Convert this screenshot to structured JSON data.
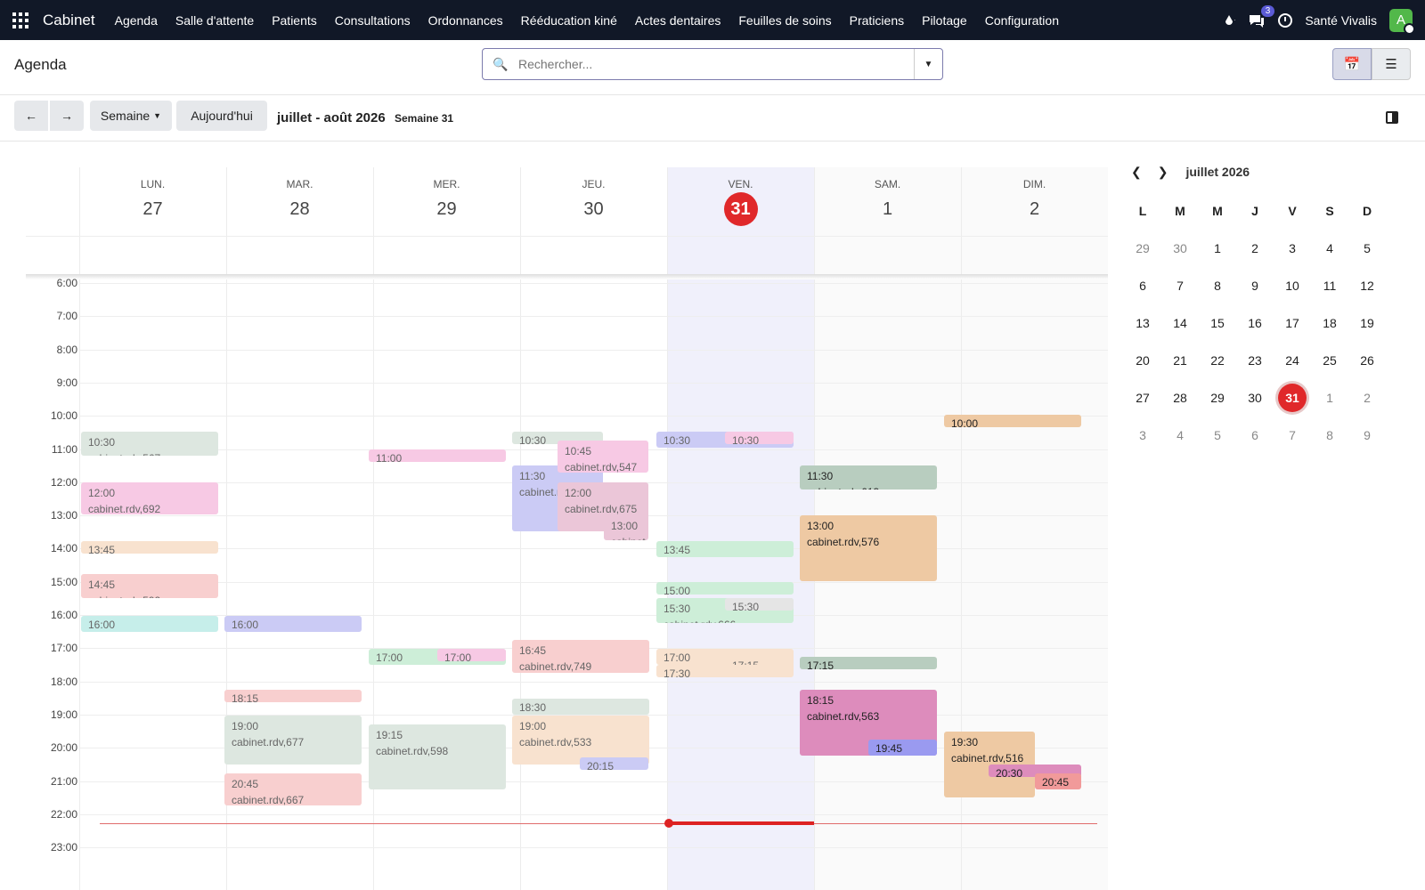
{
  "topbar": {
    "app": "Cabinet",
    "menu": [
      "Agenda",
      "Salle d'attente",
      "Patients",
      "Consultations",
      "Ordonnances",
      "Rééducation kiné",
      "Actes dentaires",
      "Feuilles de soins",
      "Praticiens",
      "Pilotage",
      "Configuration"
    ],
    "chat_count": "3",
    "company": "Santé Vivalis",
    "avatar": "A"
  },
  "control": {
    "title": "Agenda",
    "search_placeholder": "Rechercher..."
  },
  "nav": {
    "scale": "Semaine",
    "today": "Aujourd'hui",
    "range": "juillet - août 2026",
    "week": "Semaine 31"
  },
  "days": [
    {
      "name": "LUN.",
      "num": "27"
    },
    {
      "name": "MAR.",
      "num": "28"
    },
    {
      "name": "MER.",
      "num": "29"
    },
    {
      "name": "JEU.",
      "num": "30"
    },
    {
      "name": "VEN.",
      "num": "31"
    },
    {
      "name": "SAM.",
      "num": "1"
    },
    {
      "name": "DIM.",
      "num": "2"
    }
  ],
  "hours": [
    "6:00",
    "7:00",
    "8:00",
    "9:00",
    "10:00",
    "11:00",
    "12:00",
    "13:00",
    "14:00",
    "15:00",
    "16:00",
    "17:00",
    "18:00",
    "19:00",
    "20:00",
    "21:00",
    "22:00",
    "23:00"
  ],
  "events": [
    {
      "time": "10:30",
      "label": "cabinet.rdv,567",
      "color": "#dde7e0"
    },
    {
      "time": "12:00",
      "label": "cabinet.rdv,692",
      "color": "#f7c9e4"
    },
    {
      "time": "13:45",
      "label": "",
      "color": "#f8e2cf"
    },
    {
      "time": "14:45",
      "label": "cabinet.rdv,592",
      "color": "#f8cfcf"
    },
    {
      "time": "16:00",
      "label": "",
      "color": "#c6eeea"
    },
    {
      "time": "16:00",
      "label": "",
      "color": "#cbcbf5"
    },
    {
      "time": "18:15",
      "label": "",
      "color": "#f8cfcf"
    },
    {
      "time": "19:00",
      "label": "cabinet.rdv,677",
      "color": "#dde7e0"
    },
    {
      "time": "20:45",
      "label": "cabinet.rdv,667",
      "color": "#f8cfcf"
    },
    {
      "time": "11:00",
      "label": "",
      "color": "#f7c9e4"
    },
    {
      "time": "17:00",
      "label": "",
      "color": "#cdeed8"
    },
    {
      "time": "17:00",
      "label": "",
      "color": "#f7c9e4"
    },
    {
      "time": "19:15",
      "label": "cabinet.rdv,598",
      "color": "#dde7e0"
    },
    {
      "time": "10:30",
      "label": "",
      "color": "#dde7e0"
    },
    {
      "time": "11:30",
      "label": "cabinet.rdv",
      "color": "#cbcbf5"
    },
    {
      "time": "10:45",
      "label": "cabinet.rdv,547",
      "color": "#f7c9e4"
    },
    {
      "time": "12:00",
      "label": "cabinet.rdv,675",
      "color": "#ebc6d8"
    },
    {
      "time": "13:00",
      "label": "cabinet",
      "color": "#ebc6d8"
    },
    {
      "time": "16:45",
      "label": "cabinet.rdv,749",
      "color": "#f8cfcf"
    },
    {
      "time": "18:30",
      "label": "",
      "color": "#dde7e0"
    },
    {
      "time": "19:00",
      "label": "cabinet.rdv,533",
      "color": "#f8e2cf"
    },
    {
      "time": "20:15",
      "label": "",
      "color": "#cbcbf5"
    },
    {
      "time": "10:30",
      "label": "",
      "color": "#cbcbf5"
    },
    {
      "time": "10:30",
      "label": "",
      "color": "#f7c9e4"
    },
    {
      "time": "13:45",
      "label": "",
      "color": "#cdeed8"
    },
    {
      "time": "15:00",
      "label": "",
      "color": "#cdeed8"
    },
    {
      "time": "15:30",
      "label": "cabinet.rdv,666",
      "color": "#cdeed8"
    },
    {
      "time": "15:30",
      "label": "",
      "color": "#e5e5e5"
    },
    {
      "time": "17:00",
      "label": "",
      "color": "#f8e2cf"
    },
    {
      "time": "17:15",
      "label": "",
      "color": "#f8e2cf"
    },
    {
      "time": "17:30",
      "label": "",
      "color": "#f8e2cf"
    },
    {
      "time": "11:30",
      "label": "cabinet.rdv,613",
      "color": "#b8cdbf"
    },
    {
      "time": "13:00",
      "label": "cabinet.rdv,576",
      "color": "#eec9a3"
    },
    {
      "time": "17:15",
      "label": "",
      "color": "#b8cdbf"
    },
    {
      "time": "18:15",
      "label": "cabinet.rdv,563",
      "color": "#dd8cbc"
    },
    {
      "time": "19:45",
      "label": "",
      "color": "#9a9af0"
    },
    {
      "time": "10:00",
      "label": "",
      "color": "#eec9a3"
    },
    {
      "time": "19:30",
      "label": "cabinet.rdv,516",
      "color": "#eec9a3"
    },
    {
      "time": "20:30",
      "label": "",
      "color": "#dd8cbc"
    },
    {
      "time": "20:45",
      "label": "",
      "color": "#f19a9a"
    }
  ],
  "mini": {
    "title": "juillet 2026",
    "daynames": [
      "L",
      "M",
      "M",
      "J",
      "V",
      "S",
      "D"
    ],
    "rows": [
      [
        "29",
        "30",
        "1",
        "2",
        "3",
        "4",
        "5"
      ],
      [
        "6",
        "7",
        "8",
        "9",
        "10",
        "11",
        "12"
      ],
      [
        "13",
        "14",
        "15",
        "16",
        "17",
        "18",
        "19"
      ],
      [
        "20",
        "21",
        "22",
        "23",
        "24",
        "25",
        "26"
      ],
      [
        "27",
        "28",
        "29",
        "30",
        "31",
        "1",
        "2"
      ],
      [
        "3",
        "4",
        "5",
        "6",
        "7",
        "8",
        "9"
      ]
    ]
  }
}
